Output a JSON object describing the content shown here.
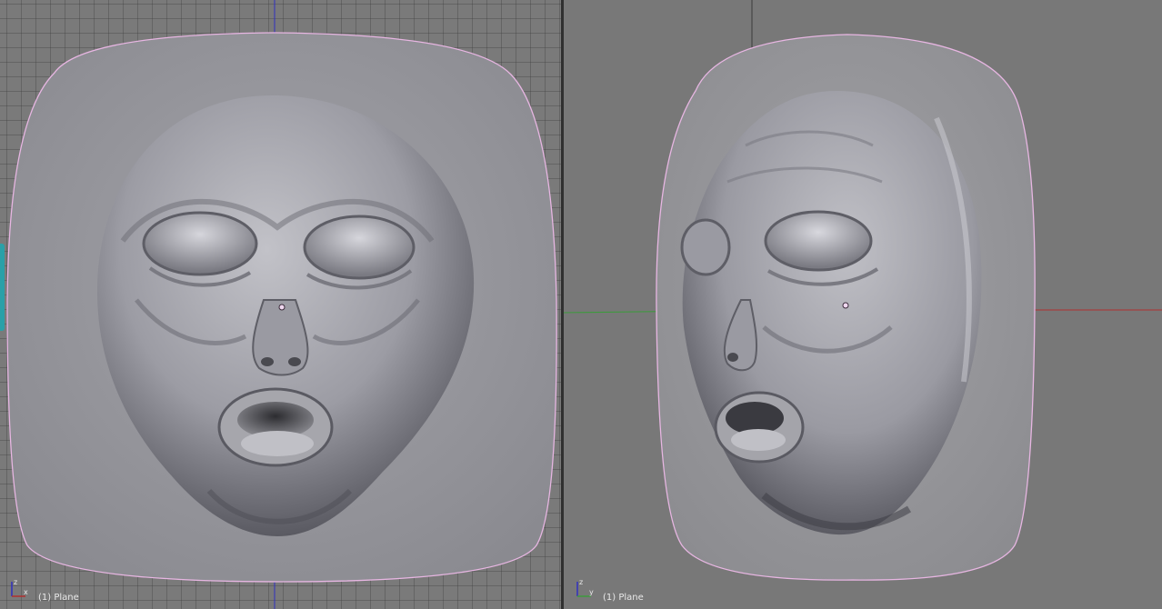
{
  "viewports": {
    "left": {
      "status_label": "(1) Plane",
      "axis_icon": "axis-xz-icon",
      "axis_labels": {
        "up": "z",
        "right": "x"
      }
    },
    "right": {
      "status_label": "(1) Plane",
      "axis_icon": "axis-yz-icon",
      "axis_labels": {
        "up": "z",
        "right": "y"
      }
    }
  },
  "colors": {
    "selection_outline": "#e7b6e2",
    "axis_green": "#3d9a3d",
    "axis_red": "#b03030",
    "axis_blue": "#3030c0",
    "panel_accent": "#2aa0a8"
  }
}
